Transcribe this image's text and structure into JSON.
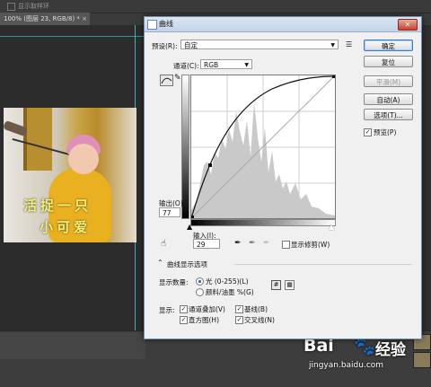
{
  "topbar": {
    "option_label": "显示取样环"
  },
  "document_tab": {
    "title": "100% (图层 23, RGB/8) *",
    "close": "×"
  },
  "photo_caption": {
    "line1": "活捉一只",
    "line2": "小可爱"
  },
  "dialog": {
    "title": "曲线",
    "close": "✕",
    "preset_label": "预设(R):",
    "preset_value": "自定",
    "channel_label": "通道(C):",
    "channel_value": "RGB",
    "output_label": "输出(O):",
    "output_value": "77",
    "input_label": "输入(I):",
    "input_value": "29",
    "show_clipping_label": "显示修剪(W)",
    "curve_options_label": "曲线显示选项",
    "show_amount_label": "显示数量:",
    "light_label": "光 (0-255)(L)",
    "pigment_label": "颜料/油墨 %(G)",
    "show_label": "显示:",
    "channel_overlay_label": "通道叠加(V)",
    "baseline_label": "基线(B)",
    "histogram_label": "直方图(H)",
    "intersection_label": "交叉线(N)",
    "buttons": {
      "ok": "确定",
      "reset": "复位",
      "smooth": "平滑(M)",
      "auto": "自动(A)",
      "options": "选项(T)..."
    },
    "preview_label": "预览(P)",
    "preview_checked": true,
    "light_selected": true
  },
  "watermark": {
    "brand": "Bai",
    "paw": "🐾",
    "suffix": "经验",
    "url": "jingyan.baidu.com"
  }
}
